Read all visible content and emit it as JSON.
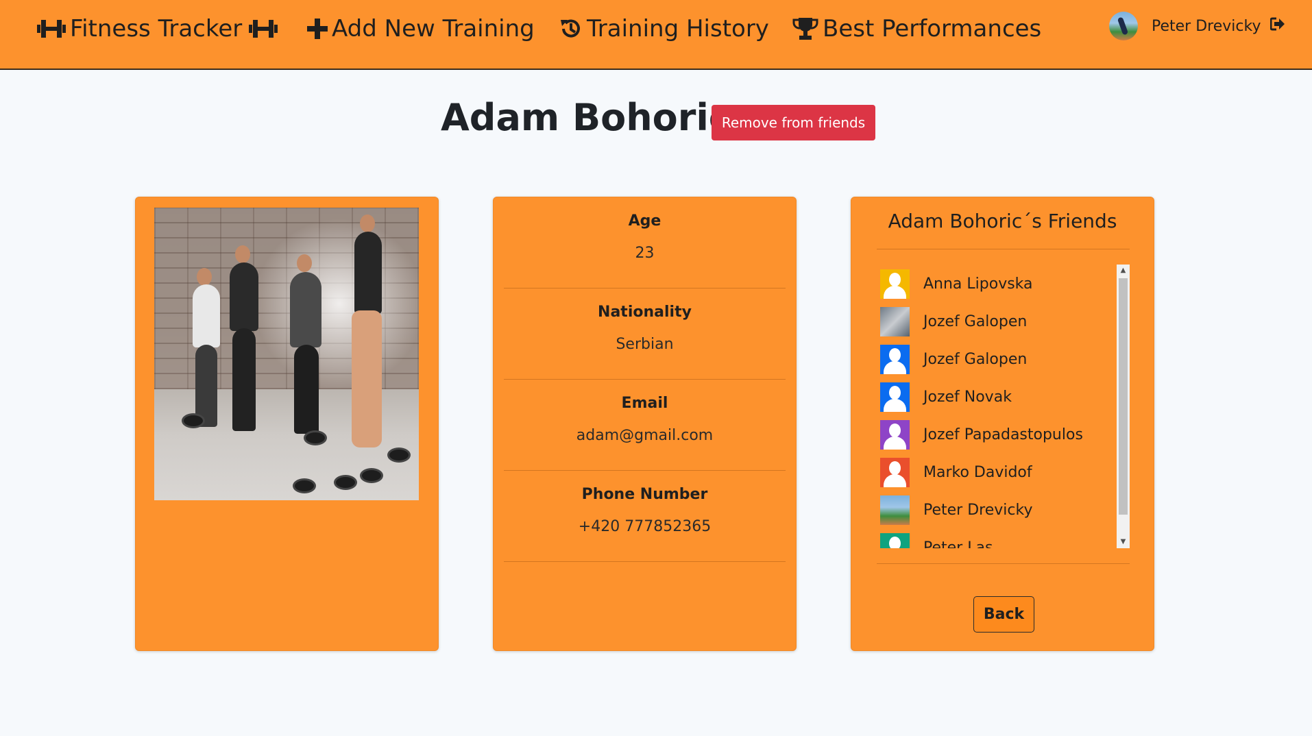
{
  "navbar": {
    "brand": "Fitness Tracker",
    "add_training": "Add New Training",
    "training_history": "Training History",
    "best_performances": "Best Performances",
    "user_name": "Peter Drevicky"
  },
  "profile": {
    "name": "Adam Bohoric",
    "remove_label": "Remove from friends"
  },
  "info": {
    "age_label": "Age",
    "age": "23",
    "nationality_label": "Nationality",
    "nationality": "Serbian",
    "email_label": "Email",
    "email": "adam@gmail.com",
    "phone_label": "Phone Number",
    "phone": "+420 777852365"
  },
  "friends": {
    "title": "Adam Bohoric´s Friends",
    "items": [
      {
        "name": "Anna Lipovska",
        "color": "#f5b800"
      },
      {
        "name": "Jozef Galopen",
        "color": "photo"
      },
      {
        "name": "Jozef Galopen",
        "color": "#0b6cf0"
      },
      {
        "name": "Jozef Novak",
        "color": "#0b6cf0"
      },
      {
        "name": "Jozef Papadastopulos",
        "color": "#8e44c7"
      },
      {
        "name": "Marko Davidof",
        "color": "#ea4f2c"
      },
      {
        "name": "Peter Drevicky",
        "color": "photo"
      },
      {
        "name": "Peter Las",
        "color": "#0fa37f"
      }
    ],
    "back_label": "Back"
  },
  "colors": {
    "accent": "#fd922d",
    "danger": "#dc3545",
    "background": "#f6f9fc"
  }
}
